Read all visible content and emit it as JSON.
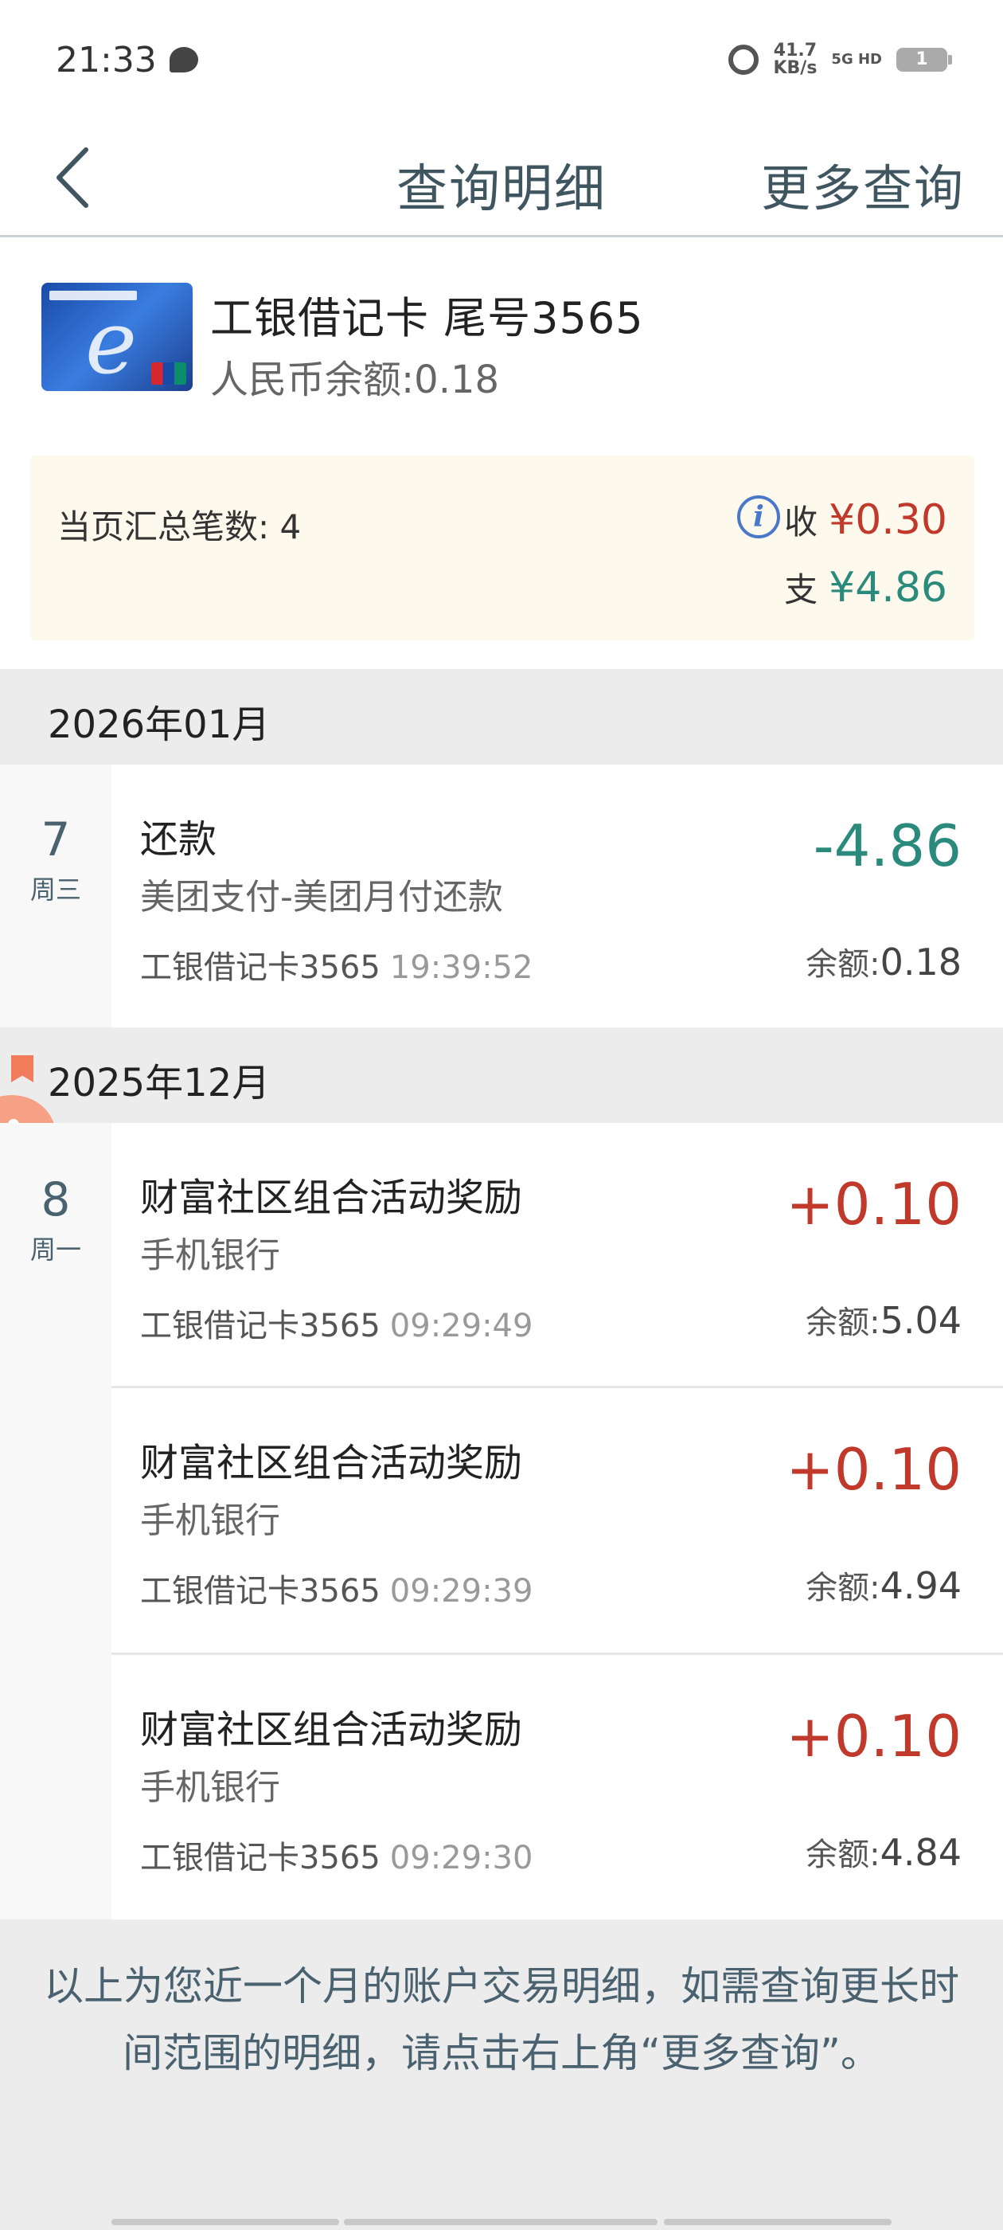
{
  "status_bar": {
    "time": "21:33",
    "speed_value": "41.7",
    "speed_unit": "KB/s",
    "network": "5G HD",
    "battery": "1"
  },
  "nav": {
    "title": "查询明细",
    "more": "更多查询"
  },
  "card": {
    "name": "工银借记卡  尾号3565",
    "balance": "人民币余额:0.18"
  },
  "summary": {
    "count_label": "当页汇总笔数: 4",
    "income_label": "收",
    "income_value": "¥0.30",
    "expense_label": "支",
    "expense_value": "¥4.86"
  },
  "months": [
    {
      "label": "2026年01月",
      "day": "7",
      "weekday": "周三",
      "transactions": [
        {
          "title": "还款",
          "sub": "美团支付-美团月付还款",
          "card": "工银借记卡3565",
          "time": "19:39:52",
          "amount": "-4.86",
          "balance_label": "余额:",
          "balance": "0.18"
        }
      ]
    },
    {
      "label": "2025年12月",
      "day": "8",
      "weekday": "周一",
      "transactions": [
        {
          "title": "财富社区组合活动奖励",
          "sub": "手机银行",
          "card": "工银借记卡3565",
          "time": "09:29:49",
          "amount": "+0.10",
          "balance_label": "余额:",
          "balance": "5.04"
        },
        {
          "title": "财富社区组合活动奖励",
          "sub": "手机银行",
          "card": "工银借记卡3565",
          "time": "09:29:39",
          "amount": "+0.10",
          "balance_label": "余额:",
          "balance": "4.94"
        },
        {
          "title": "财富社区组合活动奖励",
          "sub": "手机银行",
          "card": "工银借记卡3565",
          "time": "09:29:30",
          "amount": "+0.10",
          "balance_label": "余额:",
          "balance": "4.84"
        }
      ]
    }
  ],
  "footer": {
    "note": "以上为您近一个月的账户交易明细，如需查询更长时间范围的明细，请点击右上角“更多查询”。"
  },
  "colors": {
    "income": "#c0392b",
    "expense": "#2a8a7c",
    "nav_text": "#3f5560",
    "summary_bg": "#fdf9ec"
  }
}
